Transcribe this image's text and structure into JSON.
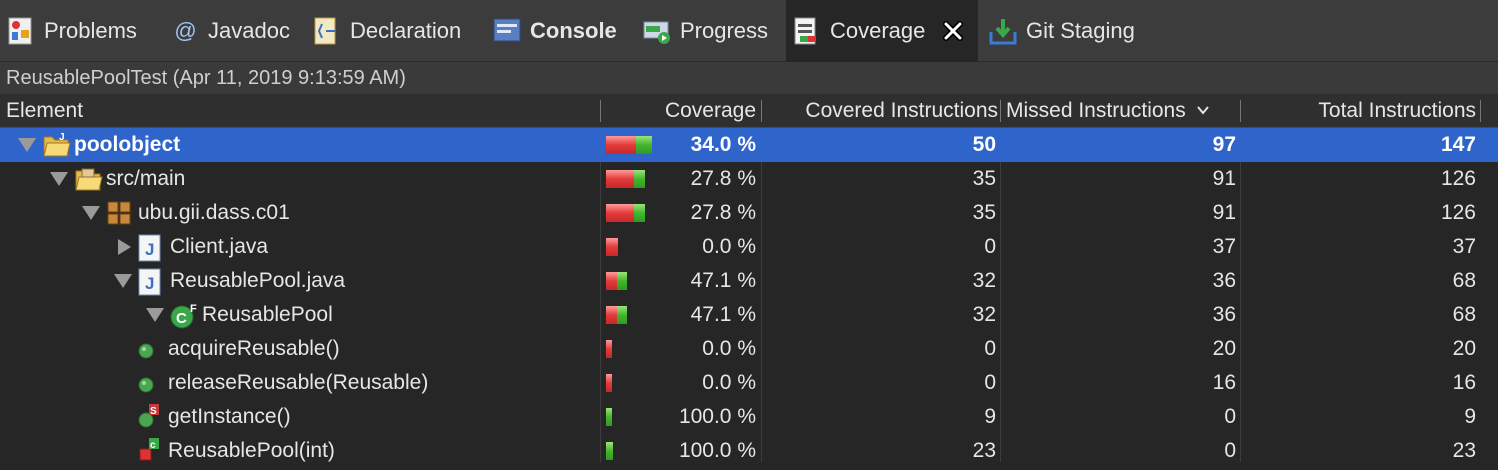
{
  "tabs": [
    {
      "label": "Problems",
      "icon": "problems-icon"
    },
    {
      "label": "Javadoc",
      "icon": "javadoc-icon"
    },
    {
      "label": "Declaration",
      "icon": "declaration-icon"
    },
    {
      "label": "Console",
      "icon": "console-icon"
    },
    {
      "label": "Progress",
      "icon": "progress-icon"
    },
    {
      "label": "Coverage",
      "icon": "coverage-icon",
      "active": true
    },
    {
      "label": "Git Staging",
      "icon": "git-staging-icon"
    }
  ],
  "session_title": "ReusablePoolTest (Apr 11, 2019 9:13:59 AM)",
  "columns": {
    "element": "Element",
    "coverage": "Coverage",
    "covered": "Covered Instructions",
    "missed": "Missed Instructions",
    "total": "Total Instructions"
  },
  "rows": [
    {
      "name": "poolobject",
      "icon": "project-icon",
      "expand": "expanded",
      "coverage_pct": 34.0,
      "coverage": "34.0 %",
      "covered": "50",
      "missed": "97",
      "total": "147",
      "selected": true
    },
    {
      "name": "src/main",
      "icon": "source-folder-icon",
      "expand": "expanded",
      "coverage_pct": 27.8,
      "coverage": "27.8 %",
      "covered": "35",
      "missed": "91",
      "total": "126"
    },
    {
      "name": "ubu.gii.dass.c01",
      "icon": "package-icon",
      "expand": "expanded",
      "coverage_pct": 27.8,
      "coverage": "27.8 %",
      "covered": "35",
      "missed": "91",
      "total": "126"
    },
    {
      "name": "Client.java",
      "icon": "java-file-icon",
      "expand": "collapsed",
      "coverage_pct": 0.0,
      "coverage": "0.0 %",
      "covered": "0",
      "missed": "37",
      "total": "37"
    },
    {
      "name": "ReusablePool.java",
      "icon": "java-file-icon",
      "expand": "expanded",
      "coverage_pct": 47.1,
      "coverage": "47.1 %",
      "covered": "32",
      "missed": "36",
      "total": "68"
    },
    {
      "name": "ReusablePool",
      "icon": "class-icon",
      "expand": "expanded",
      "coverage_pct": 47.1,
      "coverage": "47.1 %",
      "covered": "32",
      "missed": "36",
      "total": "68"
    },
    {
      "name": "acquireReusable()",
      "icon": "public-method-icon",
      "expand": "none",
      "coverage_pct": 0.0,
      "coverage": "0.0 %",
      "covered": "0",
      "missed": "20",
      "total": "20"
    },
    {
      "name": "releaseReusable(Reusable)",
      "icon": "public-method-icon",
      "expand": "none",
      "coverage_pct": 0.0,
      "coverage": "0.0 %",
      "covered": "0",
      "missed": "16",
      "total": "16"
    },
    {
      "name": "getInstance()",
      "icon": "static-method-icon",
      "expand": "none",
      "coverage_pct": 100.0,
      "coverage": "100.0 %",
      "covered": "9",
      "missed": "0",
      "total": "9"
    },
    {
      "name": "ReusablePool(int)",
      "icon": "private-constructor-icon",
      "expand": "none",
      "coverage_pct": 100.0,
      "coverage": "100.0 %",
      "covered": "23",
      "missed": "0",
      "total": "23"
    }
  ],
  "colors": {
    "selection": "#2f65ca",
    "covered": "#43b62e",
    "missed": "#e23b3b"
  }
}
